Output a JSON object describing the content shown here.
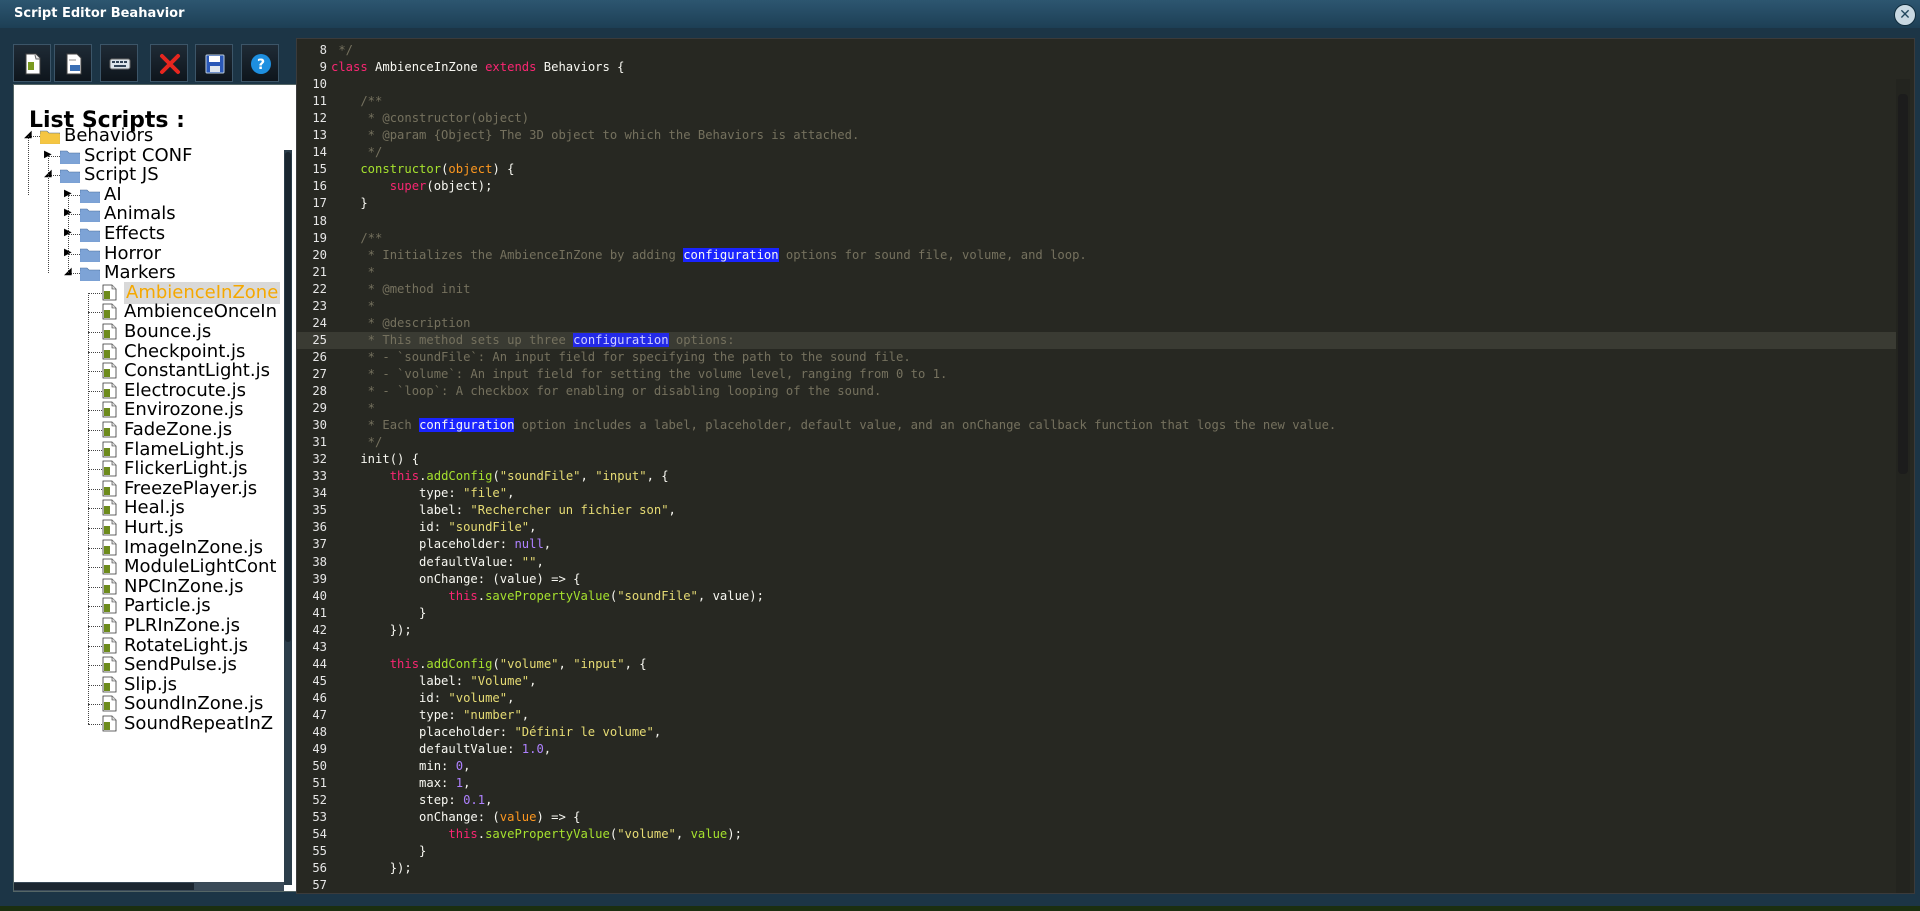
{
  "window": {
    "title": "Script Editor Beahavior",
    "close_glyph": "✕"
  },
  "toolbar": {
    "buttons": [
      {
        "name": "new-script-icon"
      },
      {
        "name": "open-document-icon"
      },
      {
        "name": "keyboard-icon"
      },
      {
        "name": "delete-icon"
      },
      {
        "name": "save-icon"
      },
      {
        "name": "help-icon",
        "glyph": "?"
      }
    ]
  },
  "sidebar": {
    "title": "List Scripts :",
    "tree": [
      {
        "label": "Behaviors",
        "type": "folder",
        "depth": 0,
        "expanded": true,
        "color": "#f4c542"
      },
      {
        "label": "Script CONF",
        "type": "folder",
        "depth": 1,
        "expanded": false
      },
      {
        "label": "Script JS",
        "type": "folder",
        "depth": 1,
        "expanded": true
      },
      {
        "label": "AI",
        "type": "folder",
        "depth": 2,
        "expanded": false
      },
      {
        "label": "Animals",
        "type": "folder",
        "depth": 2,
        "expanded": false
      },
      {
        "label": "Effects",
        "type": "folder",
        "depth": 2,
        "expanded": false
      },
      {
        "label": "Horror",
        "type": "folder",
        "depth": 2,
        "expanded": false
      },
      {
        "label": "Markers",
        "type": "folder",
        "depth": 2,
        "expanded": true
      },
      {
        "label": "AmbienceInZone",
        "type": "file",
        "depth": 3,
        "selected": true
      },
      {
        "label": "AmbienceOnceIn",
        "type": "file",
        "depth": 3
      },
      {
        "label": "Bounce.js",
        "type": "file",
        "depth": 3
      },
      {
        "label": "Checkpoint.js",
        "type": "file",
        "depth": 3
      },
      {
        "label": "ConstantLight.js",
        "type": "file",
        "depth": 3
      },
      {
        "label": "Electrocute.js",
        "type": "file",
        "depth": 3
      },
      {
        "label": "Envirozone.js",
        "type": "file",
        "depth": 3
      },
      {
        "label": "FadeZone.js",
        "type": "file",
        "depth": 3
      },
      {
        "label": "FlameLight.js",
        "type": "file",
        "depth": 3
      },
      {
        "label": "FlickerLight.js",
        "type": "file",
        "depth": 3
      },
      {
        "label": "FreezePlayer.js",
        "type": "file",
        "depth": 3
      },
      {
        "label": "Heal.js",
        "type": "file",
        "depth": 3
      },
      {
        "label": "Hurt.js",
        "type": "file",
        "depth": 3
      },
      {
        "label": "ImageInZone.js",
        "type": "file",
        "depth": 3
      },
      {
        "label": "ModuleLightCont",
        "type": "file",
        "depth": 3
      },
      {
        "label": "NPCInZone.js",
        "type": "file",
        "depth": 3
      },
      {
        "label": "Particle.js",
        "type": "file",
        "depth": 3
      },
      {
        "label": "PLRInZone.js",
        "type": "file",
        "depth": 3
      },
      {
        "label": "RotateLight.js",
        "type": "file",
        "depth": 3
      },
      {
        "label": "SendPulse.js",
        "type": "file",
        "depth": 3
      },
      {
        "label": "Slip.js",
        "type": "file",
        "depth": 3
      },
      {
        "label": "SoundInZone.js",
        "type": "file",
        "depth": 3
      },
      {
        "label": "SoundRepeatInZ",
        "type": "file",
        "depth": 3
      }
    ]
  },
  "editor": {
    "active_line": 25,
    "lines": [
      {
        "n": "8",
        "t": [
          [
            "cm",
            " */"
          ]
        ]
      },
      {
        "n": "9",
        "t": [
          [
            "k",
            "class "
          ],
          [
            "cls",
            "AmbienceInZone "
          ],
          [
            "k",
            "extends "
          ],
          [
            "cls",
            "Behaviors {"
          ]
        ]
      },
      {
        "n": "10",
        "t": []
      },
      {
        "n": "11",
        "t": [
          [
            "cm",
            "    /**"
          ]
        ]
      },
      {
        "n": "12",
        "t": [
          [
            "cm",
            "     * @constructor(object)"
          ]
        ]
      },
      {
        "n": "13",
        "t": [
          [
            "cm",
            "     * @param {Object} The 3D object to which the Behaviors is attached."
          ]
        ]
      },
      {
        "n": "14",
        "t": [
          [
            "cm",
            "     */"
          ]
        ]
      },
      {
        "n": "15",
        "t": [
          [
            "fn",
            "    constructor"
          ],
          [
            "pr",
            "("
          ],
          [
            "par",
            "object"
          ],
          [
            "pr",
            ") {"
          ]
        ]
      },
      {
        "n": "16",
        "t": [
          [
            "k",
            "        super"
          ],
          [
            "pr",
            "("
          ],
          [
            "cls",
            "object"
          ],
          [
            "pr",
            ");"
          ]
        ]
      },
      {
        "n": "17",
        "t": [
          [
            "pr",
            "    }"
          ]
        ]
      },
      {
        "n": "18",
        "t": []
      },
      {
        "n": "19",
        "t": [
          [
            "cm",
            "    /**"
          ]
        ]
      },
      {
        "n": "20",
        "t": [
          [
            "cm",
            "     * Initializes the AmbienceInZone by adding "
          ],
          [
            "hl",
            "configuration"
          ],
          [
            "cm",
            " options for sound file, volume, and loop."
          ]
        ]
      },
      {
        "n": "21",
        "t": [
          [
            "cm",
            "     *"
          ]
        ]
      },
      {
        "n": "22",
        "t": [
          [
            "cm",
            "     * @method init"
          ]
        ]
      },
      {
        "n": "23",
        "t": [
          [
            "cm",
            "     *"
          ]
        ]
      },
      {
        "n": "24",
        "t": [
          [
            "cm",
            "     * @description"
          ]
        ]
      },
      {
        "n": "25",
        "t": [
          [
            "cm",
            "     * This method sets up three "
          ],
          [
            "hlc",
            "configuration"
          ],
          [
            "cm",
            " options:"
          ]
        ]
      },
      {
        "n": "26",
        "t": [
          [
            "cm",
            "     * - `soundFile`: An input field for specifying the path to the sound file."
          ]
        ]
      },
      {
        "n": "27",
        "t": [
          [
            "cm",
            "     * - `volume`: An input field for setting the volume level, ranging from 0 to 1."
          ]
        ]
      },
      {
        "n": "28",
        "t": [
          [
            "cm",
            "     * - `loop`: A checkbox for enabling or disabling looping of the sound."
          ]
        ]
      },
      {
        "n": "29",
        "t": [
          [
            "cm",
            "     *"
          ]
        ]
      },
      {
        "n": "30",
        "t": [
          [
            "cm",
            "     * Each "
          ],
          [
            "hl",
            "configuration"
          ],
          [
            "cm",
            " option includes a label, placeholder, default value, and an onChange callback function that logs the new value."
          ]
        ]
      },
      {
        "n": "31",
        "t": [
          [
            "cm",
            "     */"
          ]
        ]
      },
      {
        "n": "32",
        "t": [
          [
            "pr",
            "    init() {"
          ]
        ]
      },
      {
        "n": "33",
        "t": [
          [
            "k",
            "        this"
          ],
          [
            "pr",
            "."
          ],
          [
            "fn",
            "addConfig"
          ],
          [
            "pr",
            "("
          ],
          [
            "s",
            "\"soundFile\""
          ],
          [
            "pr",
            ", "
          ],
          [
            "s",
            "\"input\""
          ],
          [
            "pr",
            ", {"
          ]
        ]
      },
      {
        "n": "34",
        "t": [
          [
            "pr",
            "            type: "
          ],
          [
            "s",
            "\"file\""
          ],
          [
            "pr",
            ","
          ]
        ]
      },
      {
        "n": "35",
        "t": [
          [
            "pr",
            "            label: "
          ],
          [
            "s",
            "\"Rechercher un fichier son\""
          ],
          [
            "pr",
            ","
          ]
        ]
      },
      {
        "n": "36",
        "t": [
          [
            "pr",
            "            id: "
          ],
          [
            "s",
            "\"soundFile\""
          ],
          [
            "pr",
            ","
          ]
        ]
      },
      {
        "n": "37",
        "t": [
          [
            "pr",
            "            placeholder: "
          ],
          [
            "n",
            "null"
          ],
          [
            "pr",
            ","
          ]
        ]
      },
      {
        "n": "38",
        "t": [
          [
            "pr",
            "            defaultValue: "
          ],
          [
            "s",
            "\"\""
          ],
          [
            "pr",
            ","
          ]
        ]
      },
      {
        "n": "39",
        "t": [
          [
            "pr",
            "            onChange: (value) => {"
          ]
        ]
      },
      {
        "n": "40",
        "t": [
          [
            "k",
            "                this"
          ],
          [
            "pr",
            "."
          ],
          [
            "fn",
            "savePropertyValue"
          ],
          [
            "pr",
            "("
          ],
          [
            "s",
            "\"soundFile\""
          ],
          [
            "pr",
            ", value);"
          ]
        ]
      },
      {
        "n": "41",
        "t": [
          [
            "pr",
            "            }"
          ]
        ]
      },
      {
        "n": "42",
        "t": [
          [
            "pr",
            "        });"
          ]
        ]
      },
      {
        "n": "43",
        "t": []
      },
      {
        "n": "44",
        "t": [
          [
            "k",
            "        this"
          ],
          [
            "pr",
            "."
          ],
          [
            "fn",
            "addConfig"
          ],
          [
            "pr",
            "("
          ],
          [
            "s",
            "\"volume\""
          ],
          [
            "pr",
            ", "
          ],
          [
            "s",
            "\"input\""
          ],
          [
            "pr",
            ", {"
          ]
        ]
      },
      {
        "n": "45",
        "t": [
          [
            "pr",
            "            label: "
          ],
          [
            "s",
            "\"Volume\""
          ],
          [
            "pr",
            ","
          ]
        ]
      },
      {
        "n": "46",
        "t": [
          [
            "pr",
            "            id: "
          ],
          [
            "s",
            "\"volume\""
          ],
          [
            "pr",
            ","
          ]
        ]
      },
      {
        "n": "47",
        "t": [
          [
            "pr",
            "            type: "
          ],
          [
            "s",
            "\"number\""
          ],
          [
            "pr",
            ","
          ]
        ]
      },
      {
        "n": "48",
        "t": [
          [
            "pr",
            "            placeholder: "
          ],
          [
            "s",
            "\"Définir le volume\""
          ],
          [
            "pr",
            ","
          ]
        ]
      },
      {
        "n": "49",
        "t": [
          [
            "pr",
            "            defaultValue: "
          ],
          [
            "n",
            "1.0"
          ],
          [
            "pr",
            ","
          ]
        ]
      },
      {
        "n": "50",
        "t": [
          [
            "pr",
            "            min: "
          ],
          [
            "n",
            "0"
          ],
          [
            "pr",
            ","
          ]
        ]
      },
      {
        "n": "51",
        "t": [
          [
            "pr",
            "            max: "
          ],
          [
            "n",
            "1"
          ],
          [
            "pr",
            ","
          ]
        ]
      },
      {
        "n": "52",
        "t": [
          [
            "pr",
            "            step: "
          ],
          [
            "n",
            "0.1"
          ],
          [
            "pr",
            ","
          ]
        ]
      },
      {
        "n": "53",
        "t": [
          [
            "pr",
            "            onChange: ("
          ],
          [
            "par",
            "value"
          ],
          [
            "pr",
            ") => {"
          ]
        ]
      },
      {
        "n": "54",
        "t": [
          [
            "k",
            "                this"
          ],
          [
            "pr",
            "."
          ],
          [
            "fn",
            "savePropertyValue"
          ],
          [
            "pr",
            "("
          ],
          [
            "s",
            "\"volume\""
          ],
          [
            "pr",
            ", "
          ],
          [
            "fn",
            "value"
          ],
          [
            "pr",
            ");"
          ]
        ]
      },
      {
        "n": "55",
        "t": [
          [
            "pr",
            "            }"
          ]
        ]
      },
      {
        "n": "56",
        "t": [
          [
            "pr",
            "        });"
          ]
        ]
      },
      {
        "n": "57",
        "t": []
      }
    ]
  },
  "colors": {
    "titlebar": "#1d3f55",
    "editor_bg": "#272822",
    "selection_highlight": "#1a24ff",
    "selected_file": "#f5a800"
  }
}
